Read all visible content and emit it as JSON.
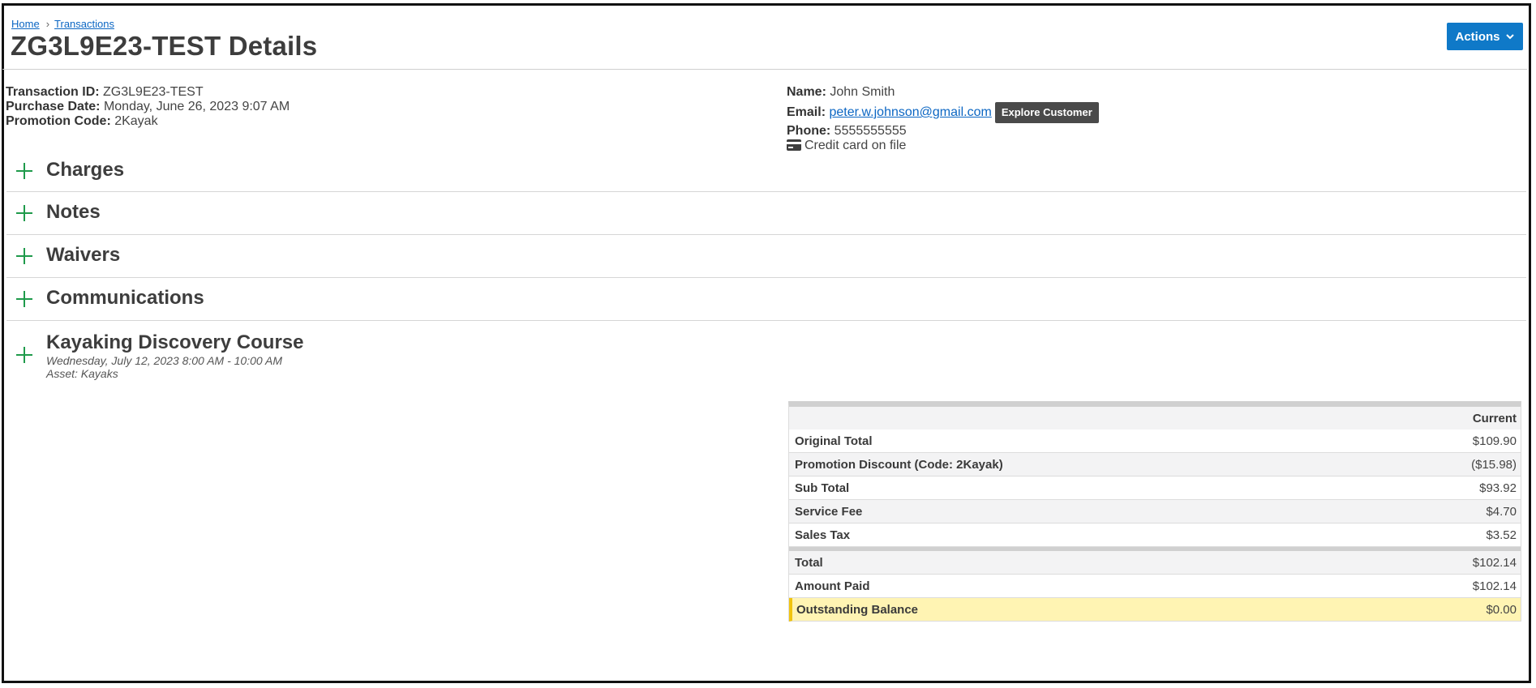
{
  "breadcrumb": {
    "home": "Home",
    "separator": "›",
    "transactions": "Transactions"
  },
  "page": {
    "title": "ZG3L9E23-TEST Details"
  },
  "actions": {
    "label": "Actions",
    "icon": "chevron-down-icon"
  },
  "transaction": {
    "id_label": "Transaction ID:",
    "id_value": " ZG3L9E23-TEST",
    "date_label": "Purchase Date:",
    "date_value": " Monday, June 26, 2023 9:07 AM",
    "promo_label": "Promotion Code:",
    "promo_value": " 2Kayak"
  },
  "customer": {
    "name_label": "Name:",
    "name_value": " John Smith",
    "email_label": "Email:",
    "email_value": "peter.w.johnson@gmail.com",
    "explore_label": "Explore Customer",
    "phone_label": "Phone:",
    "phone_value": " 5555555555",
    "card_text": "Credit card on file",
    "card_icon": "credit-card-icon"
  },
  "sections": {
    "charges": "Charges",
    "notes": "Notes",
    "waivers": "Waivers",
    "communications": "Communications",
    "course": {
      "title": "Kayaking Discovery Course",
      "date": "Wednesday, July 12, 2023 8:00 AM - 10:00 AM",
      "asset": "Asset: Kayaks"
    }
  },
  "totals": {
    "column_header": "Current",
    "rows": [
      {
        "label": "Original Total",
        "value": "$109.90"
      },
      {
        "label": "Promotion Discount (Code: 2Kayak)",
        "value": "($15.98)"
      },
      {
        "label": "Sub Total",
        "value": "$93.92"
      },
      {
        "label": "Service Fee",
        "value": "$4.70"
      },
      {
        "label": "Sales Tax",
        "value": "$3.52"
      },
      {
        "label": "Total",
        "value": "$102.14"
      },
      {
        "label": "Amount Paid",
        "value": "$102.14"
      },
      {
        "label": "Outstanding Balance",
        "value": "$0.00"
      }
    ]
  },
  "colors": {
    "accent": "#0f79c8",
    "plus": "#1f9a4b",
    "balance_bg": "#fff4b3",
    "balance_bar": "#f1c40f"
  }
}
